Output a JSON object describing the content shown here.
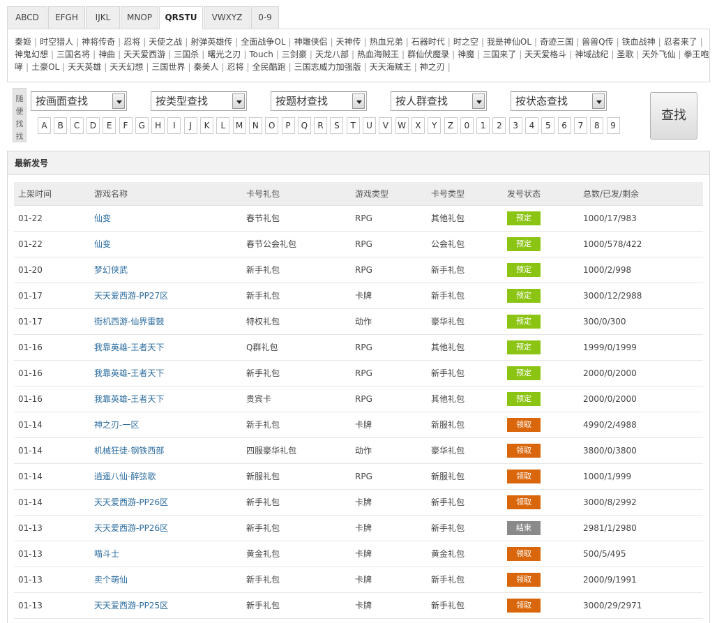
{
  "tabs": [
    {
      "label": "ABCD",
      "active": false
    },
    {
      "label": "EFGH",
      "active": false
    },
    {
      "label": "IJKL",
      "active": false
    },
    {
      "label": "MNOP",
      "active": false
    },
    {
      "label": "QRSTU",
      "active": true
    },
    {
      "label": "VWXYZ",
      "active": false
    },
    {
      "label": "0-9",
      "active": false
    }
  ],
  "games": [
    "秦姬",
    "时空猎人",
    "神将传奇",
    "忍将",
    "天使之战",
    "射弹英雄传",
    "全面战争OL",
    "神雕侠侣",
    "天神传",
    "热血兄弟",
    "石器时代",
    "时之空",
    "我是神仙OL",
    "奇迹三国",
    "兽兽Q传",
    "铁血战神",
    "忍者来了",
    "神鬼幻想",
    "三国名将",
    "神曲",
    "天天爱西游",
    "三国杀",
    "曙光之刃",
    "Touch",
    "三剑豪",
    "天龙八部",
    "热血海贼王",
    "群仙伏魔录",
    "神魔",
    "三国来了",
    "天天爱格斗",
    "神域战纪",
    "圣歌",
    "天外飞仙",
    "拳王咆哮",
    "土豪OL",
    "天天英雄",
    "天天幻想",
    "三国世界",
    "秦美人",
    "忍将",
    "全民酷跑",
    "三国志威力加强版",
    "天天海贼王",
    "神之刃"
  ],
  "search": {
    "side_label": [
      "随",
      "便",
      "找",
      "找"
    ],
    "selects": [
      "按画面查找",
      "按类型查找",
      "按题材查找",
      "按人群查找",
      "按状态查找"
    ],
    "letters": [
      "A",
      "B",
      "C",
      "D",
      "E",
      "F",
      "G",
      "H",
      "I",
      "J",
      "K",
      "L",
      "M",
      "N",
      "O",
      "P",
      "Q",
      "R",
      "S",
      "T",
      "U",
      "V",
      "W",
      "X",
      "Y",
      "Z",
      "0",
      "1",
      "2",
      "3",
      "4",
      "5",
      "6",
      "7",
      "8",
      "9"
    ],
    "button_label": "查找"
  },
  "latest": {
    "title": "最新发号",
    "columns": [
      "上架时间",
      "游戏名称",
      "卡号礼包",
      "游戏类型",
      "卡号类型",
      "发号状态",
      "总数/已发/剩余"
    ],
    "status_colors": {
      "预定": "#8cc414",
      "领取": "#d9660a",
      "结束": "#8a8a8a"
    },
    "rows": [
      {
        "date": "01-22",
        "name": "仙变",
        "pack": "春节礼包",
        "type": "RPG",
        "ctype": "其他礼包",
        "status": "预定",
        "count": "1000/17/983"
      },
      {
        "date": "01-22",
        "name": "仙变",
        "pack": "春节公会礼包",
        "type": "RPG",
        "ctype": "公会礼包",
        "status": "预定",
        "count": "1000/578/422"
      },
      {
        "date": "01-20",
        "name": "梦幻侠武",
        "pack": "新手礼包",
        "type": "RPG",
        "ctype": "新手礼包",
        "status": "预定",
        "count": "1000/2/998"
      },
      {
        "date": "01-17",
        "name": "天天爱西游-PP27区",
        "pack": "新手礼包",
        "type": "卡牌",
        "ctype": "新手礼包",
        "status": "预定",
        "count": "3000/12/2988"
      },
      {
        "date": "01-17",
        "name": "街机西游-仙界雷鼓",
        "pack": "特权礼包",
        "type": "动作",
        "ctype": "豪华礼包",
        "status": "预定",
        "count": "300/0/300"
      },
      {
        "date": "01-16",
        "name": "我靠英雄-王者天下",
        "pack": "Q群礼包",
        "type": "RPG",
        "ctype": "其他礼包",
        "status": "预定",
        "count": "1999/0/1999"
      },
      {
        "date": "01-16",
        "name": "我靠英雄-王者天下",
        "pack": "新手礼包",
        "type": "RPG",
        "ctype": "新手礼包",
        "status": "预定",
        "count": "2000/0/2000"
      },
      {
        "date": "01-16",
        "name": "我靠英雄-王者天下",
        "pack": "贵宾卡",
        "type": "RPG",
        "ctype": "其他礼包",
        "status": "预定",
        "count": "2000/0/2000"
      },
      {
        "date": "01-14",
        "name": "神之刃-一区",
        "pack": "新手礼包",
        "type": "卡牌",
        "ctype": "新服礼包",
        "status": "领取",
        "count": "4990/2/4988"
      },
      {
        "date": "01-14",
        "name": "机械狂徒-钢铁西部",
        "pack": "四服豪华礼包",
        "type": "动作",
        "ctype": "豪华礼包",
        "status": "领取",
        "count": "3800/0/3800"
      },
      {
        "date": "01-14",
        "name": "逍遥八仙-醉弦歌",
        "pack": "新服礼包",
        "type": "RPG",
        "ctype": "新服礼包",
        "status": "领取",
        "count": "1000/1/999"
      },
      {
        "date": "01-14",
        "name": "天天爱西游-PP26区",
        "pack": "新手礼包",
        "type": "卡牌",
        "ctype": "新手礼包",
        "status": "领取",
        "count": "3000/8/2992"
      },
      {
        "date": "01-13",
        "name": "天天爱西游-PP26区",
        "pack": "新手礼包",
        "type": "卡牌",
        "ctype": "新手礼包",
        "status": "结束",
        "count": "2981/1/2980"
      },
      {
        "date": "01-13",
        "name": "喵斗士",
        "pack": "黄金礼包",
        "type": "卡牌",
        "ctype": "黄金礼包",
        "status": "领取",
        "count": "500/5/495"
      },
      {
        "date": "01-13",
        "name": "卖个萌仙",
        "pack": "新手礼包",
        "type": "卡牌",
        "ctype": "新手礼包",
        "status": "领取",
        "count": "2000/9/1991"
      },
      {
        "date": "01-13",
        "name": "天天爱西游-PP25区",
        "pack": "新手礼包",
        "type": "卡牌",
        "ctype": "新手礼包",
        "status": "领取",
        "count": "3000/29/2971"
      }
    ]
  }
}
